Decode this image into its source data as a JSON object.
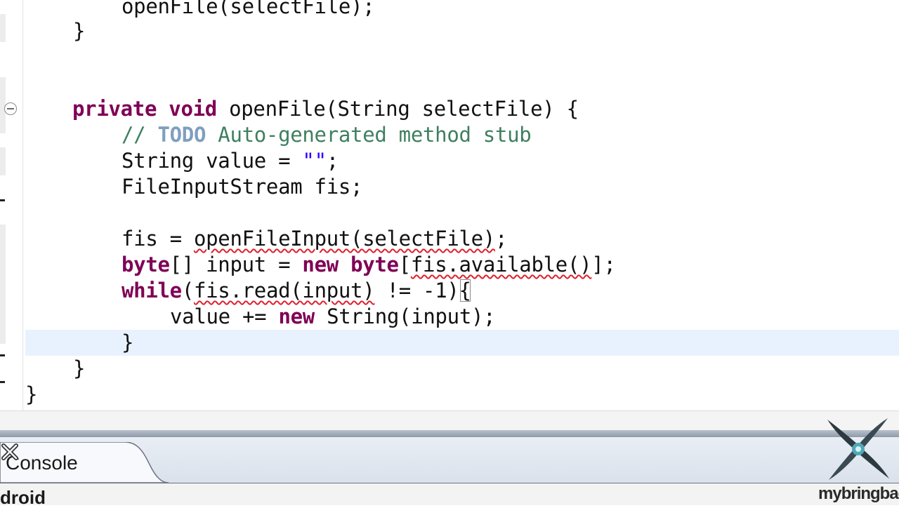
{
  "editor": {
    "lines": [
      [
        "openFile(selectFile);"
      ],
      [
        "}"
      ],
      [
        "private",
        " ",
        "void",
        " openFile(String selectFile) {"
      ],
      [
        "// ",
        "TODO",
        " Auto-generated method stub"
      ],
      [
        "String value = ",
        "\"\"",
        ";"
      ],
      [
        "FileInputStream fis;"
      ],
      [
        "fis = ",
        "openFileInput(selectFile)",
        ";"
      ],
      [
        "byte",
        "[] input = ",
        "new",
        " ",
        "byte",
        "[",
        "fis.available()",
        "];"
      ],
      [
        "while",
        "(",
        "fis.read(input)",
        " != -1)",
        "{"
      ],
      [
        "value += ",
        "new",
        " String(input);"
      ],
      [
        "}"
      ],
      [
        "}"
      ],
      [
        "}"
      ]
    ]
  },
  "panel": {
    "tab_label": "Console",
    "content_text": "droid"
  },
  "watermark": {
    "text": "mybringback"
  },
  "colors": {
    "keyword": "#7f0055",
    "comment": "#3f7f5f",
    "todo": "#7f9fbf",
    "string": "#2a00ff",
    "error_underline": "#e0202f",
    "current_line": "#e8f2fe"
  },
  "icons": {
    "fold": "collapse-minus-icon",
    "close": "close-x-icon",
    "logo": "shuriken-logo-icon"
  }
}
